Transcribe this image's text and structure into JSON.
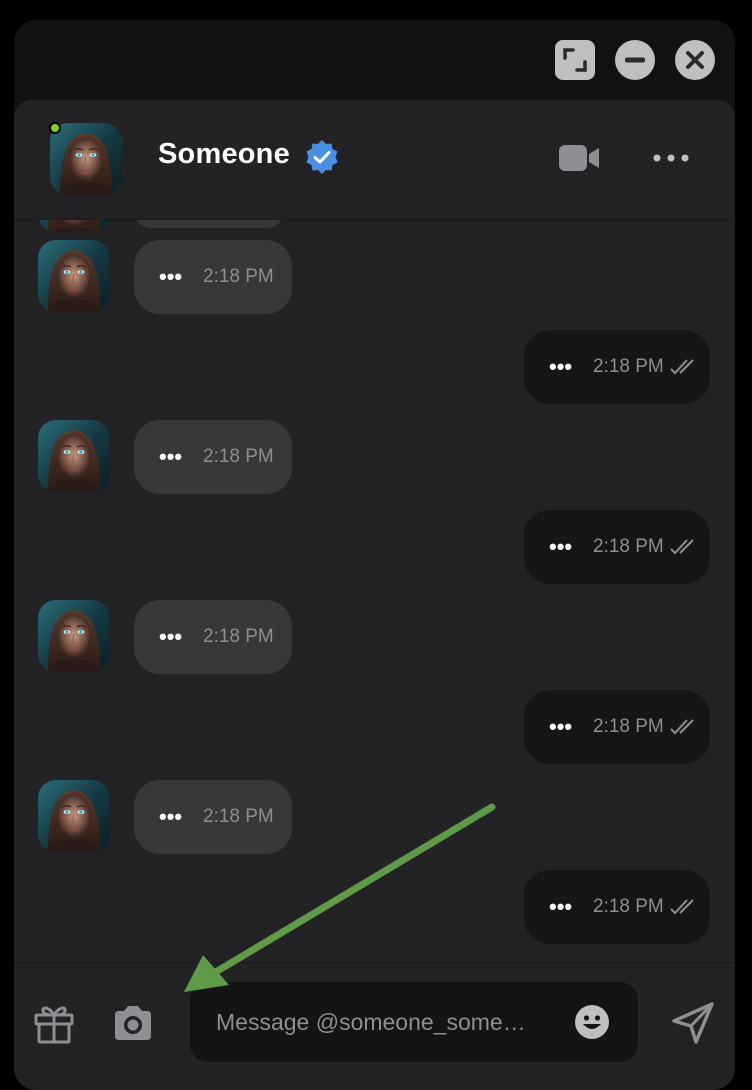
{
  "window_controls": {
    "icons": [
      "expand-icon",
      "minimize-icon",
      "close-icon"
    ]
  },
  "header": {
    "contact_name": "Someone",
    "online": true,
    "verified": true,
    "icons": [
      "video-call-icon",
      "more-options-icon"
    ]
  },
  "messages": [
    {
      "direction": "in",
      "text": "•••",
      "time": "2:18 PM"
    },
    {
      "direction": "out",
      "text": "•••",
      "time": "2:18 PM",
      "status": "read"
    },
    {
      "direction": "in",
      "text": "•••",
      "time": "2:18 PM"
    },
    {
      "direction": "out",
      "text": "•••",
      "time": "2:18 PM",
      "status": "read"
    },
    {
      "direction": "in",
      "text": "•••",
      "time": "2:18 PM"
    },
    {
      "direction": "out",
      "text": "•••",
      "time": "2:18 PM",
      "status": "read"
    },
    {
      "direction": "in",
      "text": "•••",
      "time": "2:18 PM"
    },
    {
      "direction": "out",
      "text": "•••",
      "time": "2:18 PM",
      "status": "read"
    }
  ],
  "composer": {
    "placeholder": "Message @someone_some…",
    "icons": [
      "gift-icon",
      "camera-icon",
      "emoji-icon",
      "send-icon"
    ]
  },
  "colors": {
    "online": "#7ed321",
    "verified": "#4a90e2",
    "annotation_arrow": "#5e9a47",
    "incoming_bubble": "#38383a",
    "outgoing_bubble": "#161618"
  }
}
